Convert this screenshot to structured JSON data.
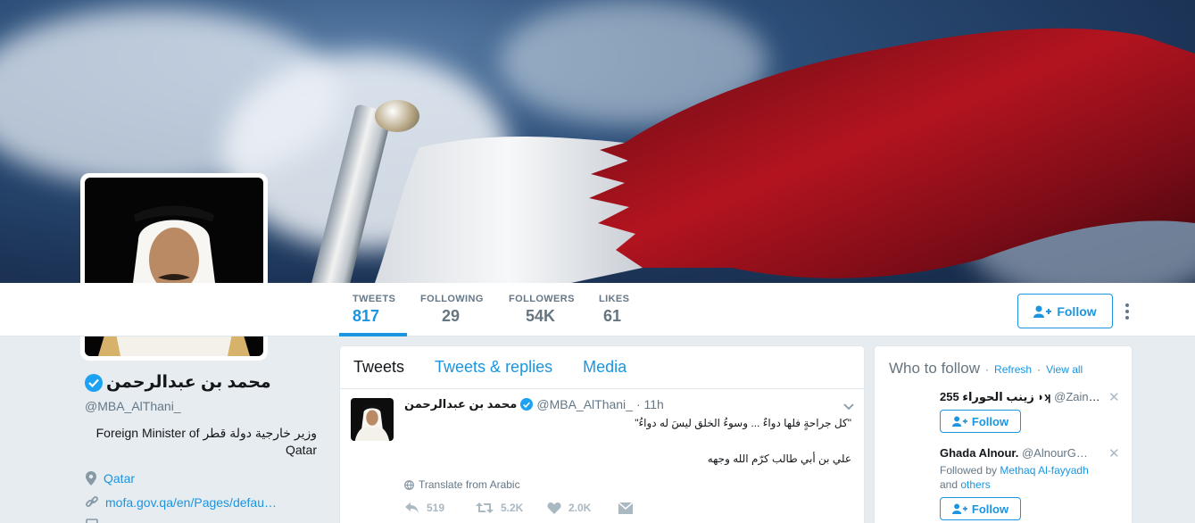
{
  "profile": {
    "name": "محمد بن عبدالرحمن",
    "handle": "@MBA_AlThani_",
    "bio": "وزير خارجية دولة قطر Foreign Minister of Qatar",
    "location": "Qatar",
    "website": "mofa.gov.qa/en/Pages/defau…"
  },
  "stats": [
    {
      "label": "TWEETS",
      "value": "817"
    },
    {
      "label": "FOLLOWING",
      "value": "29"
    },
    {
      "label": "FOLLOWERS",
      "value": "54K"
    },
    {
      "label": "LIKES",
      "value": "61"
    }
  ],
  "actions": {
    "follow_label": "Follow"
  },
  "timeline": {
    "tabs": [
      "Tweets",
      "Tweets & replies",
      "Media"
    ],
    "tweet": {
      "name": "محمد بن عبدالرحمن",
      "handle": "@MBA_AlThani_",
      "time": "· 11h",
      "line1": "\"كل جراحةٍ فلها دواءٌ ... وسوءُ الخلق ليسَ له دواءُ\"",
      "line2": "علي بن أبي طالب كرّم الله وجهه",
      "translate": "Translate from Arabic",
      "replies": "519",
      "retweets": "5.2K",
      "likes": "2.0K"
    }
  },
  "who_to_follow": {
    "title": "Who to follow",
    "refresh": "Refresh",
    "view_all": "View all",
    "dot": "·",
    "items": [
      {
        "name": "زينب الحوراء 255 ◗ʞ",
        "handle": "@Zaina…",
        "follow_label": "Follow"
      },
      {
        "name": "Ghada Alnour.",
        "handle": "@AlnourG…",
        "followed_by": "Followed by",
        "followed_by_name": "Methaq Al-fayyadh",
        "and": "and",
        "others": "others",
        "follow_label": "Follow"
      }
    ]
  },
  "colors": {
    "accent": "#1b95e0",
    "verified": "#1da1f2",
    "flag_maroon": "#8a1538"
  }
}
